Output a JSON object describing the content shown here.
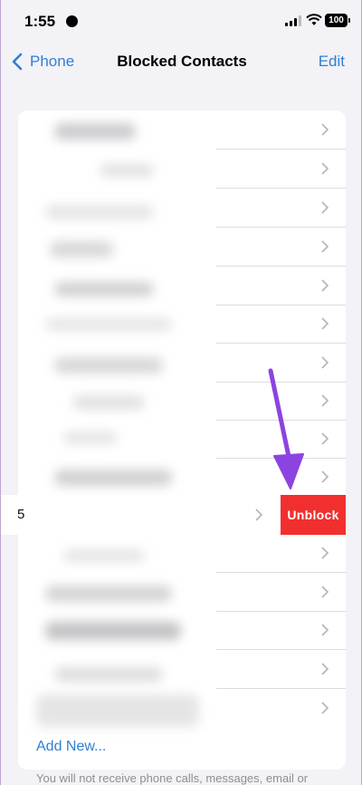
{
  "status_bar": {
    "time": "1:55",
    "battery": "100"
  },
  "nav": {
    "back_label": "Phone",
    "title": "Blocked Contacts",
    "edit_label": "Edit"
  },
  "list": {
    "swiped_row_number": "5",
    "unblock_label": "Unblock",
    "add_new_label": "Add New...",
    "footer_note": "You will not receive phone calls, messages, email or"
  },
  "colors": {
    "accent": "#2f7fd3",
    "unblock": "#f22f2f",
    "annotation_arrow": "#8b44e0"
  },
  "icons": [
    "location-icon",
    "signal-icon",
    "wifi-icon",
    "battery-icon",
    "back-chevron-icon",
    "row-chevron-icon",
    "arrow-annotation"
  ]
}
